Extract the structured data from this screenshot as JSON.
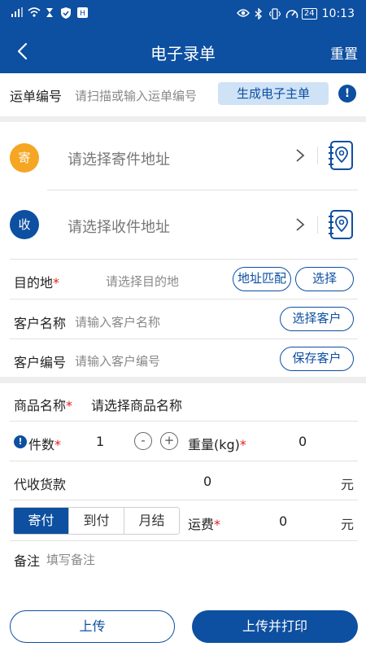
{
  "status_bar": {
    "left_icons": [
      "signal-icon",
      "wifi-icon",
      "hourglass-icon",
      "shield-icon",
      "hd-icon"
    ],
    "right_icons": [
      "eye-icon",
      "bluetooth-icon",
      "vibrate-icon",
      "speed-icon"
    ],
    "battery": "24",
    "time": "10:13"
  },
  "app_bar": {
    "title": "电子录单",
    "reset_label": "重置",
    "back_icon": "back-arrow-icon"
  },
  "waybill": {
    "label": "运单编号",
    "placeholder": "请扫描或输入运单编号",
    "generate_label": "生成电子主单",
    "info_icon": "!"
  },
  "sender": {
    "badge": "寄",
    "placeholder": "请选择寄件地址",
    "badge_color": "#f5a623"
  },
  "receiver": {
    "badge": "收",
    "placeholder": "请选择收件地址",
    "badge_color": "#0d4fa0"
  },
  "destination": {
    "label": "目的地",
    "required": "*",
    "placeholder": "请选择目的地",
    "match_label": "地址匹配",
    "select_label": "选择"
  },
  "customer_name": {
    "label": "客户名称",
    "placeholder": "请输入客户名称",
    "button": "选择客户"
  },
  "customer_code": {
    "label": "客户编号",
    "placeholder": "请输入客户编号",
    "button": "保存客户"
  },
  "product": {
    "label": "商品名称",
    "required": "*",
    "placeholder": "请选择商品名称"
  },
  "pieces": {
    "warn": "!",
    "label": "件数",
    "required": "*",
    "value": "1",
    "minus": "-",
    "plus": "+"
  },
  "weight": {
    "label": "重量(kg)",
    "required": "*",
    "value": "0"
  },
  "cod": {
    "label": "代收货款",
    "value": "0",
    "unit": "元"
  },
  "payment": {
    "options": [
      "寄付",
      "到付",
      "月结"
    ],
    "selected": "寄付"
  },
  "freight": {
    "label": "运费",
    "required": "*",
    "value": "0",
    "unit": "元"
  },
  "remark": {
    "label": "备注",
    "placeholder": "填写备注"
  },
  "actions": {
    "upload": "上传",
    "upload_print": "上传并打印"
  },
  "colors": {
    "primary": "#0d4fa0",
    "accent": "#f5a623",
    "required": "#e02020"
  }
}
